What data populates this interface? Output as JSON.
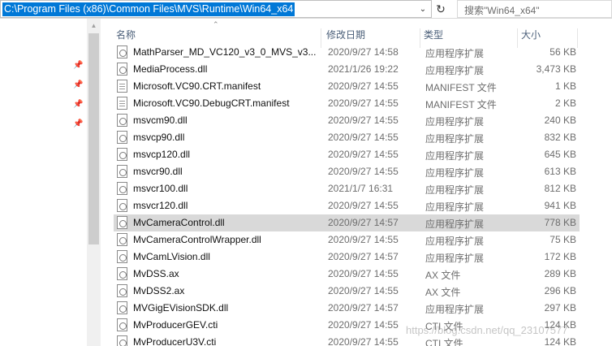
{
  "address_bar": {
    "path": "C:\\Program Files (x86)\\Common Files\\MVS\\Runtime\\Win64_x64"
  },
  "search": {
    "placeholder": "搜索\"Win64_x64\""
  },
  "columns": {
    "name": "名称",
    "date": "修改日期",
    "type": "类型",
    "size": "大小"
  },
  "files": [
    {
      "name": "MathParser_MD_VC120_v3_0_MVS_v3...",
      "date": "2020/9/27 14:58",
      "type": "应用程序扩展",
      "size": "56 KB",
      "icon": "dll-icon"
    },
    {
      "name": "MediaProcess.dll",
      "date": "2021/1/26 19:22",
      "type": "应用程序扩展",
      "size": "3,473 KB",
      "icon": "dll-icon"
    },
    {
      "name": "Microsoft.VC90.CRT.manifest",
      "date": "2020/9/27 14:55",
      "type": "MANIFEST 文件",
      "size": "1 KB",
      "icon": "file-icon"
    },
    {
      "name": "Microsoft.VC90.DebugCRT.manifest",
      "date": "2020/9/27 14:55",
      "type": "MANIFEST 文件",
      "size": "2 KB",
      "icon": "file-icon"
    },
    {
      "name": "msvcm90.dll",
      "date": "2020/9/27 14:55",
      "type": "应用程序扩展",
      "size": "240 KB",
      "icon": "dll-icon"
    },
    {
      "name": "msvcp90.dll",
      "date": "2020/9/27 14:55",
      "type": "应用程序扩展",
      "size": "832 KB",
      "icon": "dll-icon"
    },
    {
      "name": "msvcp120.dll",
      "date": "2020/9/27 14:55",
      "type": "应用程序扩展",
      "size": "645 KB",
      "icon": "dll-icon"
    },
    {
      "name": "msvcr90.dll",
      "date": "2020/9/27 14:55",
      "type": "应用程序扩展",
      "size": "613 KB",
      "icon": "dll-icon"
    },
    {
      "name": "msvcr100.dll",
      "date": "2021/1/7 16:31",
      "type": "应用程序扩展",
      "size": "812 KB",
      "icon": "dll-icon"
    },
    {
      "name": "msvcr120.dll",
      "date": "2020/9/27 14:55",
      "type": "应用程序扩展",
      "size": "941 KB",
      "icon": "dll-icon"
    },
    {
      "name": "MvCameraControl.dll",
      "date": "2020/9/27 14:57",
      "type": "应用程序扩展",
      "size": "778 KB",
      "icon": "dll-icon",
      "selected": true
    },
    {
      "name": "MvCameraControlWrapper.dll",
      "date": "2020/9/27 14:55",
      "type": "应用程序扩展",
      "size": "75 KB",
      "icon": "dll-icon"
    },
    {
      "name": "MvCamLVision.dll",
      "date": "2020/9/27 14:57",
      "type": "应用程序扩展",
      "size": "172 KB",
      "icon": "dll-icon"
    },
    {
      "name": "MvDSS.ax",
      "date": "2020/9/27 14:55",
      "type": "AX 文件",
      "size": "289 KB",
      "icon": "dll-icon"
    },
    {
      "name": "MvDSS2.ax",
      "date": "2020/9/27 14:55",
      "type": "AX 文件",
      "size": "296 KB",
      "icon": "dll-icon"
    },
    {
      "name": "MVGigEVisionSDK.dll",
      "date": "2020/9/27 14:57",
      "type": "应用程序扩展",
      "size": "297 KB",
      "icon": "dll-icon"
    },
    {
      "name": "MvProducerGEV.cti",
      "date": "2020/9/27 14:55",
      "type": "CTI 文件",
      "size": "124 KB",
      "icon": "dll-icon"
    },
    {
      "name": "MvProducerU3V.cti",
      "date": "2020/9/27 14:55",
      "type": "CTI 文件",
      "size": "124 KB",
      "icon": "dll-icon"
    }
  ],
  "watermark": "https://blog.csdn.net/qq_23107577"
}
